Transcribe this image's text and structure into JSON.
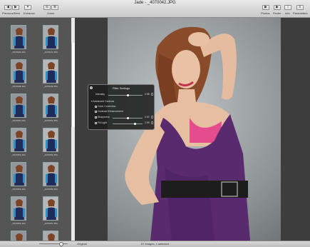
{
  "window": {
    "title": "Jade - _4070042.JPG"
  },
  "toolbar": {
    "left": [
      {
        "label": "Previous/Next",
        "buttons": [
          "◀",
          "▶"
        ]
      },
      {
        "label": "Enhance",
        "buttons": [
          "✦"
        ]
      },
      {
        "label": "Zoom",
        "buttons": [
          "⊖",
          "⊕"
        ]
      }
    ],
    "right": [
      {
        "label": "Photos",
        "icon": "photos-icon"
      },
      {
        "label": "Finder",
        "icon": "finder-icon"
      },
      {
        "label": "Info",
        "icon": "info-icon"
      },
      {
        "label": "Parameters",
        "icon": "parameters-icon"
      }
    ]
  },
  "thumbnails": [
    "_4070046.JPG",
    "_4070047.JPG",
    "_4070048.JPG",
    "_4070049.JPG",
    "_4070050.JPG",
    "_4070051.JPG",
    "_4070052.JPG",
    "_4070053.JPG",
    "_4070054.JPG",
    "_4070055.JPG",
    "_4070056.JPG",
    "_4070057.JPG",
    "_4070058.JPG",
    "_4070059.JPG"
  ],
  "hud": {
    "title": "Filter Settings",
    "intensity_label": "Intensity",
    "intensity_value": "0.58",
    "intensity_fraction": 0.58,
    "advanced_label": "Advanced Controls",
    "color_correction": "Color Correction",
    "contrast_enhancement": "Contrast Enhancement",
    "sharpness_label": "Sharpness",
    "sharpness_value": "0.51",
    "sharpness_fraction": 0.51,
    "fill_light_label": "Fill Light",
    "fill_light_value": "2.99",
    "fill_light_fraction": 0.75
  },
  "bottom": {
    "original_label": "Original",
    "status": "67 images, 1 selected"
  },
  "colors": {
    "sidebar_bg": "#555555",
    "dress": "#5a2a6e",
    "accent": "#e54c8e"
  }
}
